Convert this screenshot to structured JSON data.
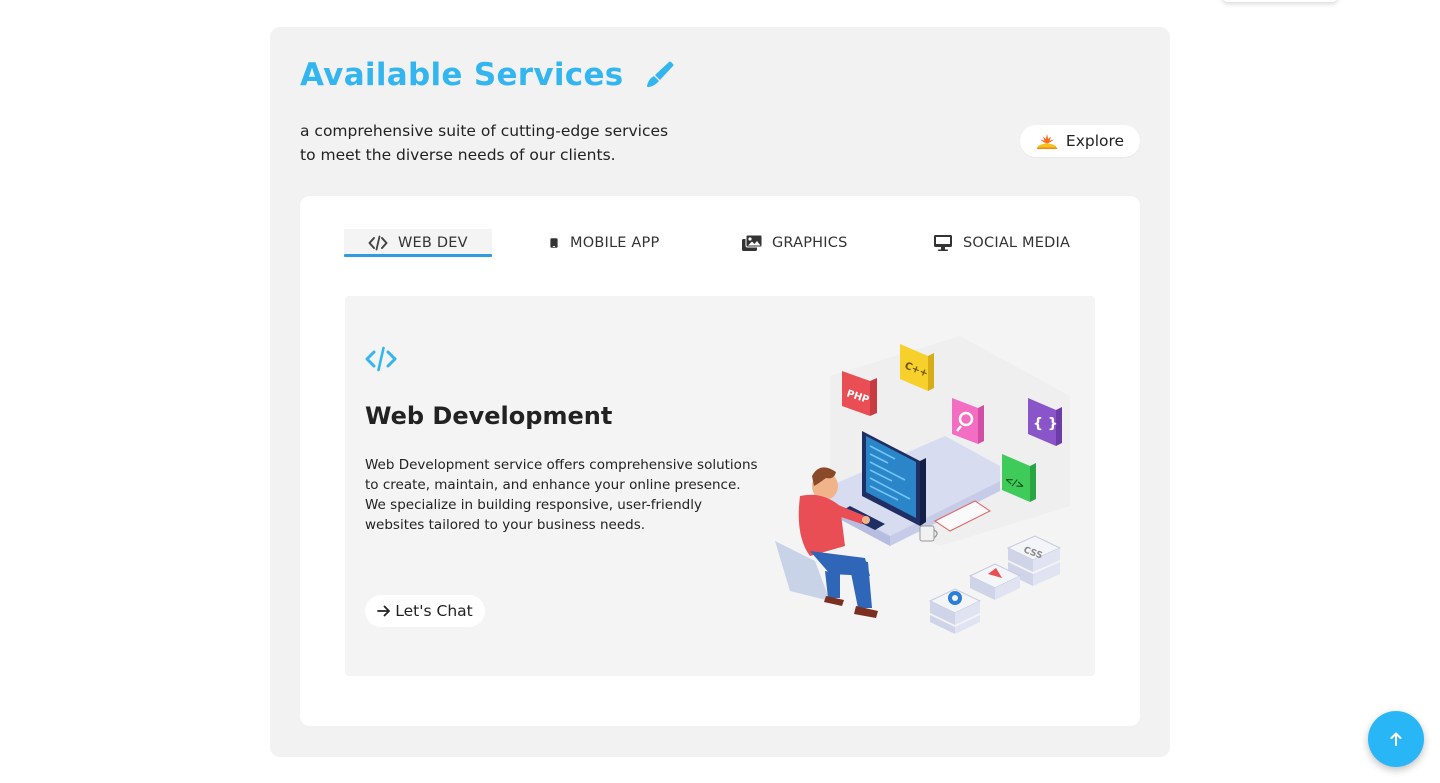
{
  "header": {
    "title": "Available Services",
    "subtitle_line1": "a comprehensive suite of cutting-edge services",
    "subtitle_line2": "to meet the diverse needs of our clients.",
    "explore_label": "Explore"
  },
  "tabs": [
    {
      "label": "WEB DEV",
      "icon": "code-icon",
      "active": true
    },
    {
      "label": "MOBILE APP",
      "icon": "mobile-icon",
      "active": false
    },
    {
      "label": "GRAPHICS",
      "icon": "images-icon",
      "active": false
    },
    {
      "label": "SOCIAL MEDIA",
      "icon": "desktop-icon",
      "active": false
    }
  ],
  "panel": {
    "icon": "code-icon",
    "title": "Web Development",
    "description": "Web Development service offers comprehensive solutions to create, maintain, and enhance your online presence. We specialize in building responsive, user-friendly websites tailored to your business needs.",
    "chat_label": "Let's Chat",
    "illustration_labels": {
      "php": "PHP",
      "cpp": "C++",
      "css": "CSS",
      "braces": "{ }",
      "code": "</>"
    }
  },
  "colors": {
    "accent": "#33b5f0",
    "tab_underline": "#2f9be0",
    "scroll_button": "#29b6f6"
  }
}
